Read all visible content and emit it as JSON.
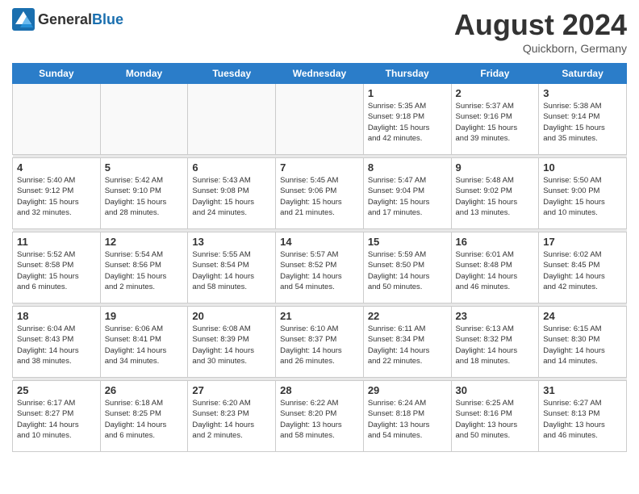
{
  "header": {
    "logo_general": "General",
    "logo_blue": "Blue",
    "title": "August 2024",
    "subtitle": "Quickborn, Germany"
  },
  "days_of_week": [
    "Sunday",
    "Monday",
    "Tuesday",
    "Wednesday",
    "Thursday",
    "Friday",
    "Saturday"
  ],
  "weeks": [
    [
      {
        "day": "",
        "info": ""
      },
      {
        "day": "",
        "info": ""
      },
      {
        "day": "",
        "info": ""
      },
      {
        "day": "",
        "info": ""
      },
      {
        "day": "1",
        "info": "Sunrise: 5:35 AM\nSunset: 9:18 PM\nDaylight: 15 hours\nand 42 minutes."
      },
      {
        "day": "2",
        "info": "Sunrise: 5:37 AM\nSunset: 9:16 PM\nDaylight: 15 hours\nand 39 minutes."
      },
      {
        "day": "3",
        "info": "Sunrise: 5:38 AM\nSunset: 9:14 PM\nDaylight: 15 hours\nand 35 minutes."
      }
    ],
    [
      {
        "day": "4",
        "info": "Sunrise: 5:40 AM\nSunset: 9:12 PM\nDaylight: 15 hours\nand 32 minutes."
      },
      {
        "day": "5",
        "info": "Sunrise: 5:42 AM\nSunset: 9:10 PM\nDaylight: 15 hours\nand 28 minutes."
      },
      {
        "day": "6",
        "info": "Sunrise: 5:43 AM\nSunset: 9:08 PM\nDaylight: 15 hours\nand 24 minutes."
      },
      {
        "day": "7",
        "info": "Sunrise: 5:45 AM\nSunset: 9:06 PM\nDaylight: 15 hours\nand 21 minutes."
      },
      {
        "day": "8",
        "info": "Sunrise: 5:47 AM\nSunset: 9:04 PM\nDaylight: 15 hours\nand 17 minutes."
      },
      {
        "day": "9",
        "info": "Sunrise: 5:48 AM\nSunset: 9:02 PM\nDaylight: 15 hours\nand 13 minutes."
      },
      {
        "day": "10",
        "info": "Sunrise: 5:50 AM\nSunset: 9:00 PM\nDaylight: 15 hours\nand 10 minutes."
      }
    ],
    [
      {
        "day": "11",
        "info": "Sunrise: 5:52 AM\nSunset: 8:58 PM\nDaylight: 15 hours\nand 6 minutes."
      },
      {
        "day": "12",
        "info": "Sunrise: 5:54 AM\nSunset: 8:56 PM\nDaylight: 15 hours\nand 2 minutes."
      },
      {
        "day": "13",
        "info": "Sunrise: 5:55 AM\nSunset: 8:54 PM\nDaylight: 14 hours\nand 58 minutes."
      },
      {
        "day": "14",
        "info": "Sunrise: 5:57 AM\nSunset: 8:52 PM\nDaylight: 14 hours\nand 54 minutes."
      },
      {
        "day": "15",
        "info": "Sunrise: 5:59 AM\nSunset: 8:50 PM\nDaylight: 14 hours\nand 50 minutes."
      },
      {
        "day": "16",
        "info": "Sunrise: 6:01 AM\nSunset: 8:48 PM\nDaylight: 14 hours\nand 46 minutes."
      },
      {
        "day": "17",
        "info": "Sunrise: 6:02 AM\nSunset: 8:45 PM\nDaylight: 14 hours\nand 42 minutes."
      }
    ],
    [
      {
        "day": "18",
        "info": "Sunrise: 6:04 AM\nSunset: 8:43 PM\nDaylight: 14 hours\nand 38 minutes."
      },
      {
        "day": "19",
        "info": "Sunrise: 6:06 AM\nSunset: 8:41 PM\nDaylight: 14 hours\nand 34 minutes."
      },
      {
        "day": "20",
        "info": "Sunrise: 6:08 AM\nSunset: 8:39 PM\nDaylight: 14 hours\nand 30 minutes."
      },
      {
        "day": "21",
        "info": "Sunrise: 6:10 AM\nSunset: 8:37 PM\nDaylight: 14 hours\nand 26 minutes."
      },
      {
        "day": "22",
        "info": "Sunrise: 6:11 AM\nSunset: 8:34 PM\nDaylight: 14 hours\nand 22 minutes."
      },
      {
        "day": "23",
        "info": "Sunrise: 6:13 AM\nSunset: 8:32 PM\nDaylight: 14 hours\nand 18 minutes."
      },
      {
        "day": "24",
        "info": "Sunrise: 6:15 AM\nSunset: 8:30 PM\nDaylight: 14 hours\nand 14 minutes."
      }
    ],
    [
      {
        "day": "25",
        "info": "Sunrise: 6:17 AM\nSunset: 8:27 PM\nDaylight: 14 hours\nand 10 minutes."
      },
      {
        "day": "26",
        "info": "Sunrise: 6:18 AM\nSunset: 8:25 PM\nDaylight: 14 hours\nand 6 minutes."
      },
      {
        "day": "27",
        "info": "Sunrise: 6:20 AM\nSunset: 8:23 PM\nDaylight: 14 hours\nand 2 minutes."
      },
      {
        "day": "28",
        "info": "Sunrise: 6:22 AM\nSunset: 8:20 PM\nDaylight: 13 hours\nand 58 minutes."
      },
      {
        "day": "29",
        "info": "Sunrise: 6:24 AM\nSunset: 8:18 PM\nDaylight: 13 hours\nand 54 minutes."
      },
      {
        "day": "30",
        "info": "Sunrise: 6:25 AM\nSunset: 8:16 PM\nDaylight: 13 hours\nand 50 minutes."
      },
      {
        "day": "31",
        "info": "Sunrise: 6:27 AM\nSunset: 8:13 PM\nDaylight: 13 hours\nand 46 minutes."
      }
    ]
  ]
}
